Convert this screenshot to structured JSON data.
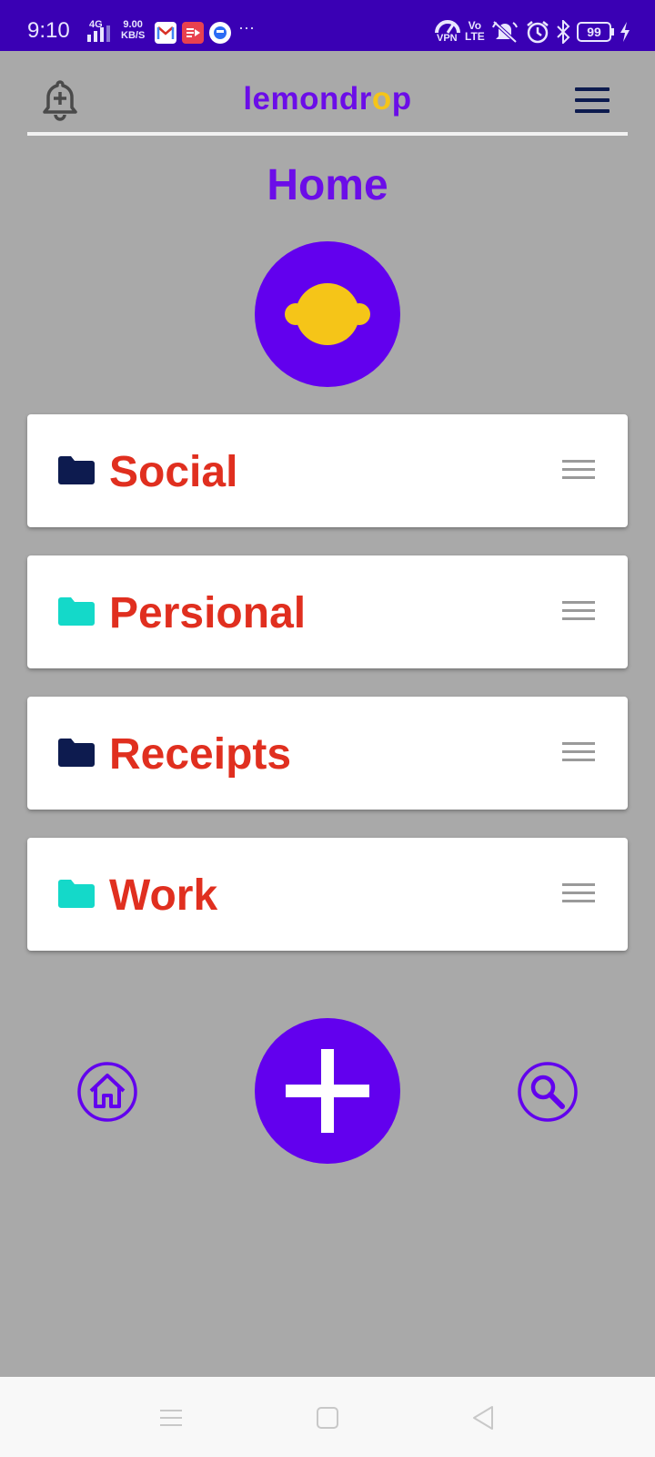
{
  "status_bar": {
    "time": "9:10",
    "network": "4G",
    "speed_value": "9.00",
    "speed_unit": "KB/S",
    "more": "···",
    "vpn": "VPN",
    "volte_top": "Vo",
    "volte_bottom": "LTE",
    "battery": "99",
    "icons": [
      "signal-icon",
      "gmail-icon",
      "video-app-icon",
      "mi-app-icon",
      "vpn-icon",
      "mute-icon",
      "alarm-icon",
      "bluetooth-icon",
      "battery-icon",
      "charging-icon"
    ]
  },
  "header": {
    "brand_prefix": "lemondr",
    "brand_highlight": "o",
    "brand_suffix": "p",
    "icons": [
      "add-notification-icon",
      "menu-icon"
    ]
  },
  "page": {
    "title": "Home"
  },
  "folders": [
    {
      "label": "Social",
      "color": "#0d1b4f"
    },
    {
      "label": "Persional",
      "color": "#14d9c9"
    },
    {
      "label": "Receipts",
      "color": "#0d1b4f"
    },
    {
      "label": "Work",
      "color": "#14d9c9"
    }
  ],
  "bottom_nav": {
    "icons": [
      "home-icon",
      "plus-icon",
      "search-icon"
    ]
  },
  "colors": {
    "primary": "#6200ee",
    "title": "#6b0de8",
    "folder_label": "#e02f1f",
    "lemon": "#f5c518",
    "background": "#a9a9a9"
  }
}
